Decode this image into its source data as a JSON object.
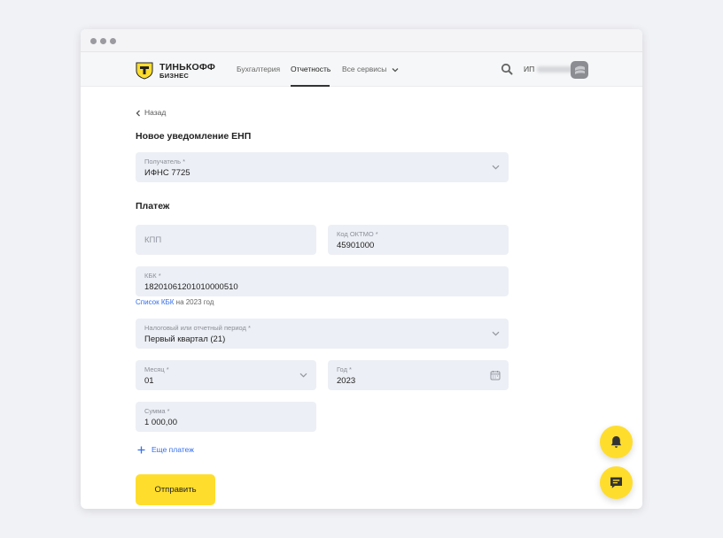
{
  "brand": {
    "name": "ТИНЬКОФФ",
    "subtitle": "БИЗНЕС"
  },
  "nav": {
    "items": [
      {
        "label": "Бухгалтерия"
      },
      {
        "label": "Отчетность"
      },
      {
        "label": "Все сервисы"
      }
    ],
    "active": "Отчетность",
    "user_label": "ИП"
  },
  "back_label": "Назад",
  "page_title": "Новое уведомление ЕНП",
  "recipient": {
    "label": "Получатель *",
    "value": "ИФНС 7725"
  },
  "payment_section_title": "Платеж",
  "kpp": {
    "placeholder": "КПП"
  },
  "oktmo": {
    "label": "Код ОКТМО *",
    "value": "45901000"
  },
  "kbk": {
    "label": "КБК *",
    "value": "18201061201010000510",
    "hint_link": "Список КБК",
    "hint_text": " на 2023 год"
  },
  "period": {
    "label": "Налоговый или отчетный период *",
    "value": "Первый квартал (21)"
  },
  "month": {
    "label": "Месяц *",
    "value": "01"
  },
  "year": {
    "label": "Год *",
    "value": "2023"
  },
  "amount": {
    "label": "Сумма *",
    "value": "1 000,00"
  },
  "more_payment_label": "Еще платеж",
  "submit_label": "Отправить",
  "colors": {
    "accent": "#ffdd2d",
    "link": "#336fee",
    "field_bg": "#eceff5"
  },
  "icons": [
    "search-icon",
    "chevron-down-icon",
    "chevron-left-icon",
    "calendar-icon",
    "plus-icon",
    "bell-icon",
    "chat-icon"
  ]
}
